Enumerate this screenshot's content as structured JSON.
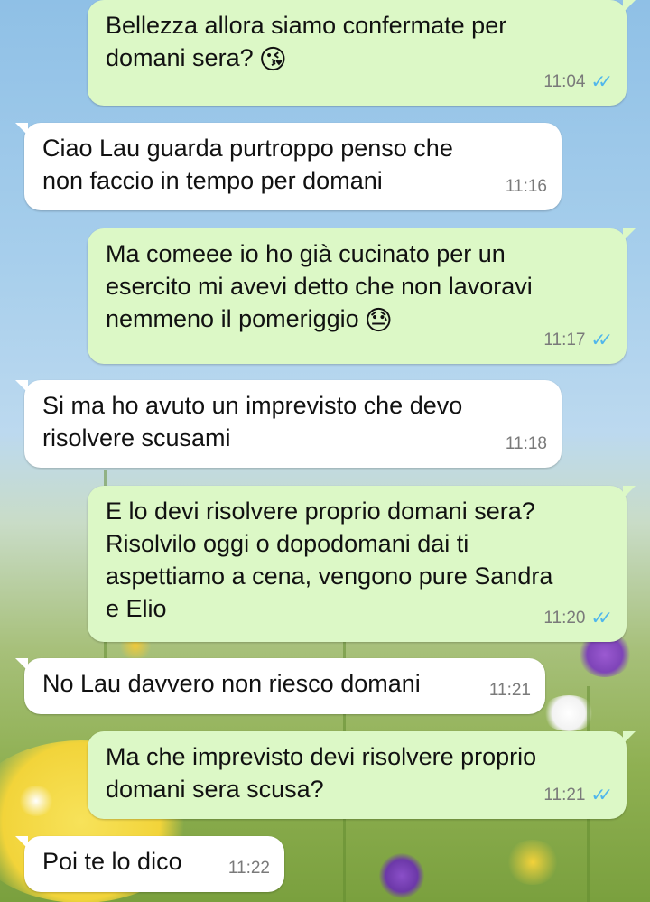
{
  "messages": [
    {
      "dir": "out",
      "text": "Bellezza allora siamo confermate per\ndomani sera?",
      "emoji": "😘",
      "time": "11:04",
      "read": true
    },
    {
      "dir": "in",
      "text": "Ciao Lau guarda purtroppo penso che\nnon faccio in tempo per domani",
      "time": "11:16"
    },
    {
      "dir": "out",
      "text": "Ma comeee io ho già cucinato per un\nesercito mi avevi detto che non lavoravi\nnemmeno il pomeriggio",
      "emoji": "😓",
      "time": "11:17",
      "read": true
    },
    {
      "dir": "in",
      "text": "Si ma ho avuto un imprevisto che devo\nrisolvere scusami",
      "time": "11:18"
    },
    {
      "dir": "out",
      "text": "E lo devi risolvere proprio domani sera?\nRisolvilo oggi o dopodomani dai ti\naspettiamo a cena, vengono pure Sandra\ne Elio",
      "time": "11:20",
      "read": true
    },
    {
      "dir": "in",
      "text": "No Lau davvero non riesco domani",
      "time": "11:21"
    },
    {
      "dir": "out",
      "text": "Ma che imprevisto devi risolvere proprio\ndomani sera scusa?",
      "time": "11:21",
      "read": true
    },
    {
      "dir": "in",
      "text": "Poi te lo dico",
      "time": "11:22"
    }
  ],
  "colors": {
    "outgoing": "#dcf8c6",
    "incoming": "#ffffff",
    "read_ticks": "#4fb6ec"
  },
  "icons": {
    "read_receipt": "double-check-icon"
  }
}
